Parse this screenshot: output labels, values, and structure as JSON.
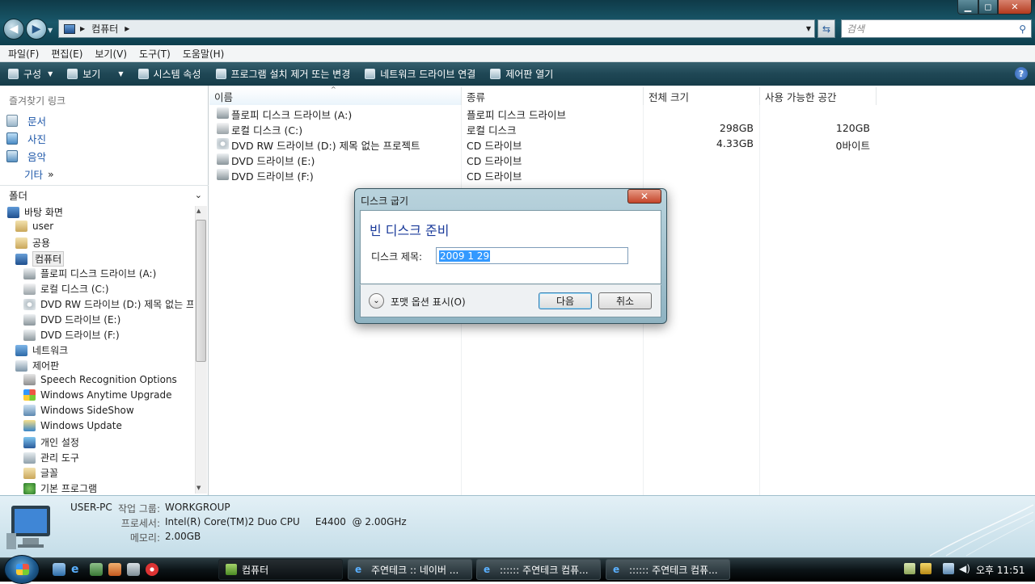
{
  "window": {
    "address_path": [
      "컴퓨터"
    ],
    "search_placeholder": "검색",
    "controls": {
      "minimize": "▁",
      "maximize": "◻",
      "close": "✕"
    }
  },
  "menu": [
    "파일(F)",
    "편집(E)",
    "보기(V)",
    "도구(T)",
    "도움말(H)"
  ],
  "toolbar": [
    {
      "label": "구성",
      "icon": "organize-icon",
      "dropdown": true
    },
    {
      "label": "보기",
      "icon": "views-icon",
      "dropdown": true
    },
    {
      "label": "시스템 속성",
      "icon": "system-properties-icon"
    },
    {
      "label": "프로그램 설치 제거 또는 변경",
      "icon": "uninstall-program-icon"
    },
    {
      "label": "네트워크 드라이브 연결",
      "icon": "map-network-drive-icon"
    },
    {
      "label": "제어판 열기",
      "icon": "control-panel-icon"
    }
  ],
  "favorites": {
    "header": "즐겨찾기 링크",
    "items": [
      "문서",
      "사진",
      "음악"
    ],
    "more": "기타",
    "more_glyph": "»"
  },
  "folders": {
    "header": "폴더",
    "tree": [
      {
        "label": "바탕 화면",
        "level": 0,
        "icon": "desktop-icon"
      },
      {
        "label": "user",
        "level": 1,
        "icon": "user-folder-icon"
      },
      {
        "label": "공용",
        "level": 1,
        "icon": "public-folder-icon"
      },
      {
        "label": "컴퓨터",
        "level": 1,
        "icon": "computer-icon",
        "selected": true
      },
      {
        "label": "플로피 디스크 드라이브 (A:)",
        "level": 2,
        "icon": "floppy-drive-icon"
      },
      {
        "label": "로컬 디스크 (C:)",
        "level": 2,
        "icon": "local-disk-icon"
      },
      {
        "label": "DVD RW 드라이브 (D:) 제목 없는 프로젝트",
        "level": 2,
        "icon": "dvd-rw-icon"
      },
      {
        "label": "DVD 드라이브 (E:)",
        "level": 2,
        "icon": "dvd-drive-icon"
      },
      {
        "label": "DVD 드라이브 (F:)",
        "level": 2,
        "icon": "dvd-drive-icon"
      },
      {
        "label": "네트워크",
        "level": 1,
        "icon": "network-icon"
      },
      {
        "label": "제어판",
        "level": 1,
        "icon": "control-panel-icon"
      },
      {
        "label": "Speech Recognition Options",
        "level": 2,
        "icon": "microphone-icon"
      },
      {
        "label": "Windows Anytime Upgrade",
        "level": 2,
        "icon": "windows-flag-icon"
      },
      {
        "label": "Windows SideShow",
        "level": 2,
        "icon": "sideshow-icon"
      },
      {
        "label": "Windows Update",
        "level": 2,
        "icon": "windows-update-icon"
      },
      {
        "label": "개인 설정",
        "level": 2,
        "icon": "personalize-icon"
      },
      {
        "label": "관리 도구",
        "level": 2,
        "icon": "admin-tools-icon"
      },
      {
        "label": "글꼴",
        "level": 2,
        "icon": "fonts-folder-icon"
      },
      {
        "label": "기본 프로그램",
        "level": 2,
        "icon": "default-programs-icon"
      }
    ]
  },
  "columns": [
    "이름",
    "종류",
    "전체 크기",
    "사용 가능한 공간"
  ],
  "drives": [
    {
      "name": "플로피 디스크 드라이브 (A:)",
      "type": "플로피 디스크 드라이브",
      "total": "",
      "free": "",
      "icon": "floppy-drive-icon"
    },
    {
      "name": "로컬 디스크 (C:)",
      "type": "로컬 디스크",
      "total": "298GB",
      "free": "120GB",
      "icon": "local-disk-icon"
    },
    {
      "name": "DVD RW 드라이브 (D:) 제목 없는 프로젝트",
      "type": "CD 드라이브",
      "total": "4.33GB",
      "free": "0바이트",
      "icon": "dvd-rw-icon"
    },
    {
      "name": "DVD 드라이브 (E:)",
      "type": "CD 드라이브",
      "total": "",
      "free": "",
      "icon": "dvd-drive-icon"
    },
    {
      "name": "DVD 드라이브 (F:)",
      "type": "CD 드라이브",
      "total": "",
      "free": "",
      "icon": "dvd-drive-icon"
    }
  ],
  "dialog": {
    "title": "디스크 굽기",
    "heading": "빈 디스크 준비",
    "label": "디스크 제목:",
    "value": "2009 1 29",
    "format_toggle": "포맷 옵션 표시(O)",
    "next": "다음",
    "cancel": "취소"
  },
  "details": {
    "computer_name": "USER-PC",
    "workgroup_label": "작업 그룹:",
    "workgroup": "WORKGROUP",
    "processor_label": "프로세서:",
    "processor": "Intel(R) Core(TM)2 Duo CPU     E4400  @ 2.00GHz",
    "memory_label": "메모리:",
    "memory": "2.00GB"
  },
  "taskbar": {
    "tasks": [
      {
        "label": "컴퓨터",
        "active": true,
        "icon": "computer-icon"
      },
      {
        "label": "주연테크 :: 네이버 ...",
        "icon": "ie-icon"
      },
      {
        "label": ":::::: 주연테크 컴퓨...",
        "icon": "ie-icon"
      },
      {
        "label": ":::::: 주연테크 컴퓨...",
        "icon": "ie-icon"
      }
    ],
    "clock": "오후 11:51"
  }
}
